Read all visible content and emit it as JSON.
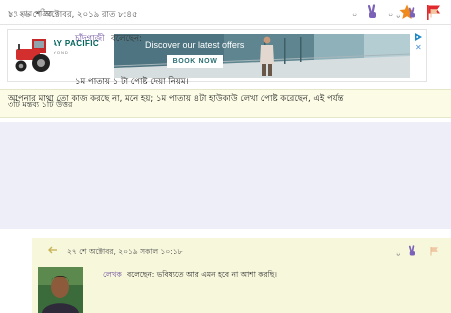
{
  "post_meta": {
    "read_count": "৮৭ বার পঠিত",
    "like_count": "০",
    "favorite_count": "০"
  },
  "ad": {
    "brand": "CATHAY PACIFIC",
    "tagline": "MOVE BEYOND",
    "headline": "Discover our latest offers",
    "cta": "BOOK NOW",
    "close": "✕"
  },
  "comments_summary": "৩টি মন্তব্য ১টি উত্তর",
  "comments": [
    {
      "number": "১.",
      "date": "২৬ শে অক্টোবর, ২০১৯ রাত ৮:৪৫",
      "likes": "০",
      "author": "চাঁদগাজী",
      "says": "বলেছেন:",
      "lines": [
        "১ম পাতায় ১ টা পোষ্ট দেয়া নিয়ম।",
        "আপনার মাথা তো কাজ করছে না, মনে হয়; ১ম পাতায় ৪টা হাউকাউ লেখা পোষ্ট করেছেন, এই পর্যন্ত"
      ]
    },
    {
      "date": "২৭ শে অক্টোবর, ২০১৯ সকাল ১০:১৮",
      "likes": "০",
      "author": "লেখক",
      "says": "বলেছেন: ভবিষ্যতে আর এমন হবে না আশা করছি।"
    }
  ],
  "colors": {
    "summary_bg": "#fbfbe6",
    "comment_bg": "#eeeef8",
    "reply_bg": "#f7f7dc",
    "author_color": "#6a4c9c",
    "flag_red": "#e0282d",
    "star_orange": "#f08a1c",
    "peace_purple": "#7b62b8"
  }
}
